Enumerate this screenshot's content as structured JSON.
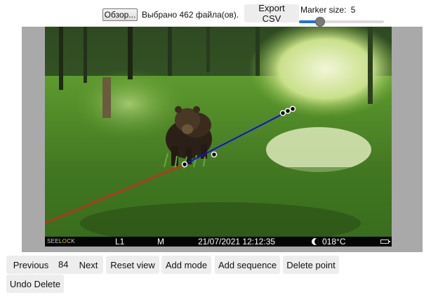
{
  "toolbar": {
    "browse_label": "Обзор...",
    "file_status": "Выбрано 462 файла(ов).",
    "export_label": "Export CSV",
    "marker_size_label": "Marker size:",
    "marker_size_value": "5",
    "marker_size": {
      "min": 1,
      "max": 20,
      "value": 5
    }
  },
  "image_overlay": {
    "brand_prefix": "SEEL",
    "brand_highlight": "O",
    "brand_suffix": "CK",
    "camera": "L1",
    "mode": "M",
    "datetime": "21/07/2021 12:12:35",
    "temperature": "018°C",
    "moon_icon": "moon-phase-icon",
    "battery_icon": "battery-icon"
  },
  "annotations": {
    "colors": {
      "segment_1": "#e21f1f",
      "segment_2": "#1010d8",
      "point_fill": "#000000",
      "point_stroke": "#ffffff"
    }
  },
  "controls": {
    "previous_label": "Previous",
    "page_number": "84",
    "next_label": "Next",
    "reset_view_label": "Reset view",
    "add_mode_label": "Add mode",
    "add_sequence_label": "Add sequence",
    "delete_point_label": "Delete point",
    "undo_delete_label": "Undo Delete"
  }
}
